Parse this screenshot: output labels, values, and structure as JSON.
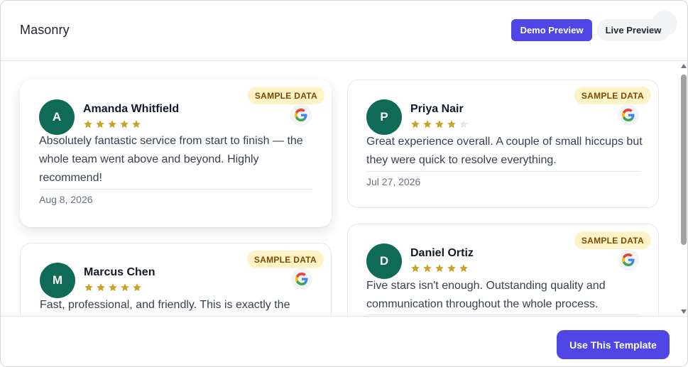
{
  "header": {
    "title": "Masonry",
    "demo_preview_label": "Demo Preview",
    "live_preview_label": "Live Preview"
  },
  "sample_badge": "SAMPLE DATA",
  "reviews": [
    {
      "initial": "A",
      "name": "Amanda Whitfield",
      "rating": 5,
      "text": "Absolutely fantastic service from start to finish — the whole team went above and beyond. Highly recommend!",
      "date": "Aug 8, 2026",
      "source_icon": "google-icon"
    },
    {
      "initial": "P",
      "name": "Priya Nair",
      "rating": 4,
      "text": "Great experience overall. A couple of small hiccups but they were quick to resolve everything.",
      "date": "Jul 27, 2026",
      "source_icon": "google-icon"
    },
    {
      "initial": "M",
      "name": "Marcus Chen",
      "rating": 5,
      "text": "Fast, professional, and friendly. This is exactly the",
      "date": "",
      "source_icon": "google-icon"
    },
    {
      "initial": "D",
      "name": "Daniel Ortiz",
      "rating": 5,
      "text": "Five stars isn't enough. Outstanding quality and communication throughout the whole process.",
      "date": "",
      "source_icon": "google-icon"
    }
  ],
  "footer": {
    "use_template_label": "Use This Template"
  },
  "colors": {
    "accent": "#4f46e5",
    "avatar": "#0f6b57",
    "star_filled": "#c9a227",
    "star_empty": "#e5e7eb",
    "badge_bg": "#fdf3c7",
    "badge_text": "#7c4a03"
  }
}
